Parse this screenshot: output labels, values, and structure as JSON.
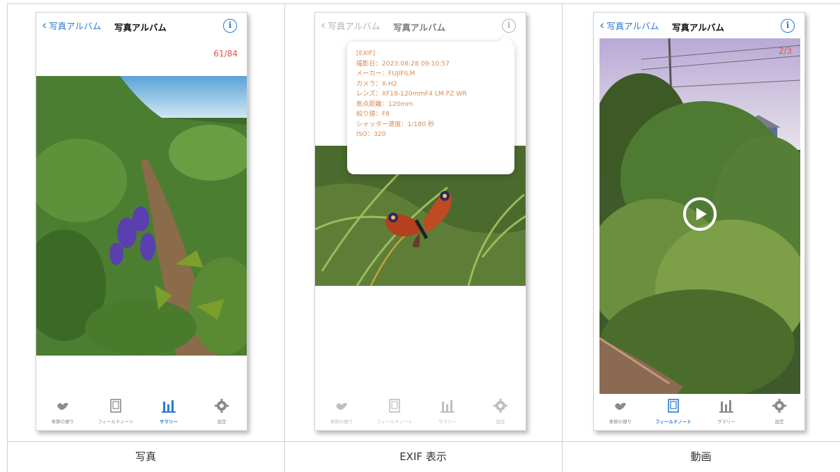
{
  "captions": [
    "写真",
    "EXIF 表示",
    "動画"
  ],
  "screens": [
    {
      "nav": {
        "back_label": "写真アルバム",
        "title": "写真アルバム"
      },
      "counter": "61/84",
      "tabs": [
        "季節の便り",
        "フィールドノート",
        "サマリー",
        "設定"
      ],
      "active_tab": "サマリー"
    },
    {
      "nav": {
        "back_label": "写真アルバム",
        "title": "写真アルバム"
      },
      "exif": {
        "lines": [
          "[EXIF]",
          "撮影日：2023:08:28 09:10:57",
          "メーカー：FUJIFILM",
          "カメラ：X-H2",
          "レンズ：XF18-120mmF4 LM PZ WR",
          "焦点距離：120mm",
          "絞り値：F8",
          "シャッター速度：1/180 秒",
          "ISO：320"
        ]
      },
      "tabs": [
        "季節の便り",
        "フィールドノート",
        "サマリー",
        "設定"
      ]
    },
    {
      "nav": {
        "back_label": "写真アルバム",
        "title": "写真アルバム"
      },
      "counter": "2/3",
      "tabs": [
        "季節の便り",
        "フィールドノート",
        "サマリー",
        "設定"
      ],
      "active_tab": "フィールドノート"
    }
  ],
  "colors": {
    "accent": "#2a7ad1",
    "counter": "#e2544b",
    "exif_text": "#d88a55"
  },
  "icons": {
    "info": "info-circle-icon",
    "back": "chevron-left-icon",
    "play": "play-circle-icon"
  }
}
